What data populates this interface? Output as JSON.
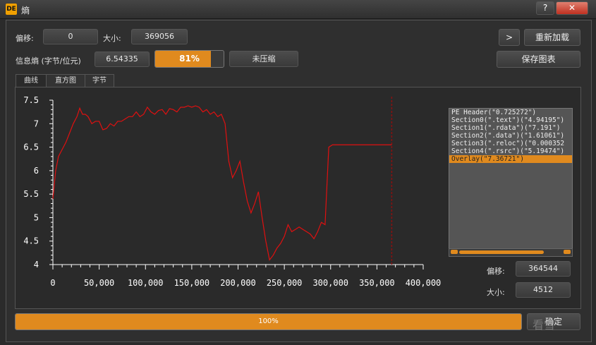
{
  "window": {
    "title": "熵",
    "help": "?",
    "close": "✕"
  },
  "top": {
    "offset_label": "偏移:",
    "offset_value": "0",
    "size_label": "大小:",
    "size_value": "369056",
    "entropy_label": "信息熵 (字节/位元)",
    "entropy_value": "6.54335",
    "entropy_percent": "81%",
    "entropy_fraction": 0.81,
    "status": "未压缩",
    "nav_button": ">",
    "reload_button": "重新加载",
    "save_chart_button": "保存图表"
  },
  "tabs": [
    {
      "label": "曲线"
    },
    {
      "label": "直方图"
    },
    {
      "label": "字节"
    }
  ],
  "sections": [
    {
      "label": "PE Header(\"0.725272\")"
    },
    {
      "label": "Section0(\".text\")(\"4.94195\")"
    },
    {
      "label": "Section1(\".rdata\")(\"7.191\")"
    },
    {
      "label": "Section2(\".data\")(\"1.61061\")"
    },
    {
      "label": "Section3(\".reloc\")(\"0.000352"
    },
    {
      "label": "Section4(\".rsrc\")(\"5.19474\")"
    },
    {
      "label": "Overlay(\"7.36721\")"
    }
  ],
  "selected_section": "Overlay(\"7.36721\")",
  "detail": {
    "offset_label": "偏移:",
    "offset_value": "364544",
    "size_label": "大小:",
    "size_value": "4512"
  },
  "progress": {
    "text": "100%",
    "fraction": 1.0
  },
  "ok_button": "确定",
  "watermark": "看雪",
  "colors": {
    "accent": "#e08a1e",
    "line": "#e01010",
    "marker": "#8a1010"
  },
  "chart_data": {
    "type": "line",
    "title": "",
    "xlabel": "",
    "ylabel": "",
    "xlim": [
      0,
      400000
    ],
    "ylim": [
      4,
      7.5
    ],
    "x_ticks": [
      0,
      50000,
      100000,
      150000,
      200000,
      250000,
      300000,
      350000,
      400000
    ],
    "x_tick_labels": [
      "0",
      "50,000",
      "100,000",
      "150,000",
      "200,000",
      "250,000",
      "300,000",
      "350,000",
      "400,000"
    ],
    "y_ticks": [
      4,
      4.5,
      5,
      5.5,
      6,
      6.5,
      7,
      7.5
    ],
    "y_tick_labels": [
      "4",
      "4.5",
      "5",
      "5.5",
      "6",
      "6.5",
      "7",
      "7.5"
    ],
    "marker_x": 366000,
    "series": [
      {
        "x": [
          0,
          3000,
          6000,
          10000,
          14000,
          18000,
          22000,
          26000,
          29000,
          32000,
          35000,
          38000,
          42000,
          46000,
          50000,
          54000,
          58000,
          62000,
          66000,
          70000,
          74000,
          78000,
          82000,
          86000,
          90000,
          94000,
          98000,
          102000,
          106000,
          110000,
          114000,
          118000,
          122000,
          126000,
          130000,
          134000,
          138000,
          142000,
          146000,
          150000,
          154000,
          158000,
          162000,
          166000,
          170000,
          174000,
          178000,
          182000,
          186000,
          190000,
          194000,
          198000,
          202000,
          206000,
          210000,
          214000,
          218000,
          222000,
          226000,
          230000,
          234000,
          238000,
          242000,
          246000,
          250000,
          254000,
          258000,
          262000,
          266000,
          270000,
          274000,
          278000,
          282000,
          286000,
          290000,
          294000,
          298000,
          302000,
          306000,
          310000,
          314000,
          318000,
          322000,
          326000,
          329000,
          332000,
          350000,
          366000
        ],
        "y": [
          5.4,
          6.0,
          6.3,
          6.45,
          6.6,
          6.8,
          7.0,
          7.15,
          7.33,
          7.2,
          7.2,
          7.15,
          7.0,
          7.05,
          7.05,
          6.87,
          6.9,
          7.0,
          6.95,
          7.05,
          7.05,
          7.1,
          7.15,
          7.15,
          7.25,
          7.15,
          7.2,
          7.35,
          7.25,
          7.2,
          7.28,
          7.3,
          7.2,
          7.32,
          7.3,
          7.25,
          7.35,
          7.35,
          7.38,
          7.35,
          7.38,
          7.35,
          7.25,
          7.3,
          7.2,
          7.25,
          7.15,
          7.2,
          7.0,
          6.2,
          5.85,
          6.0,
          6.2,
          5.75,
          5.35,
          5.1,
          5.3,
          5.55,
          5.0,
          4.5,
          4.1,
          4.2,
          4.35,
          4.45,
          4.6,
          4.85,
          4.7,
          4.75,
          4.8,
          4.75,
          4.7,
          4.65,
          4.55,
          4.7,
          4.9,
          4.85,
          6.5,
          6.55,
          6.55,
          6.55,
          6.55,
          6.55,
          6.55,
          6.55,
          6.55,
          6.55,
          6.55,
          6.55
        ]
      }
    ]
  }
}
